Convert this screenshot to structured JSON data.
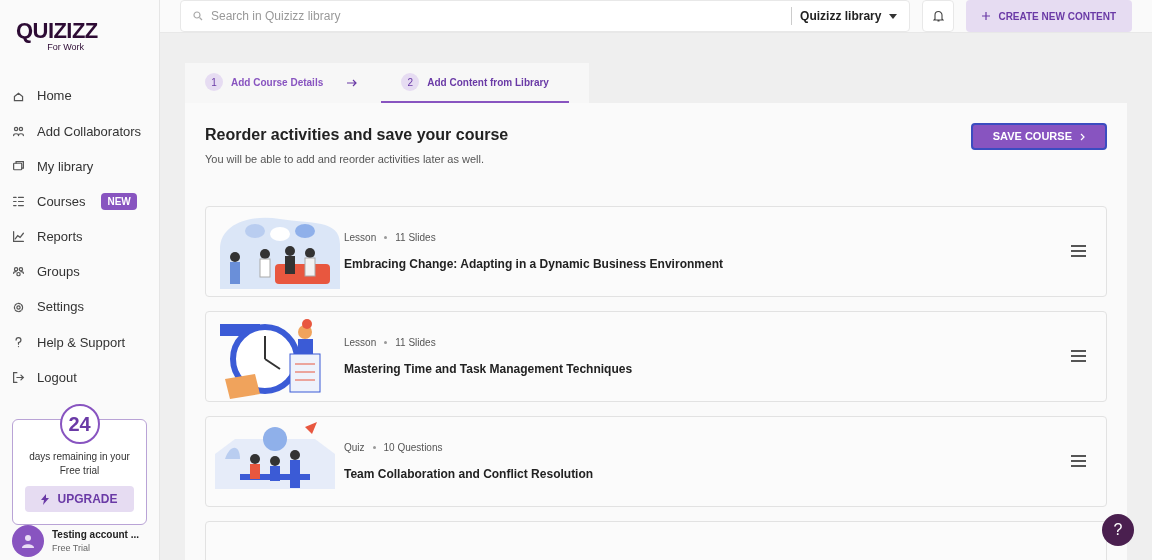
{
  "logo": {
    "name": "QUIZIZZ",
    "sub": "For Work"
  },
  "sidebar": {
    "items": [
      {
        "label": "Home"
      },
      {
        "label": "Add Collaborators"
      },
      {
        "label": "My library"
      },
      {
        "label": "Courses",
        "badge": "NEW"
      },
      {
        "label": "Reports"
      },
      {
        "label": "Groups"
      },
      {
        "label": "Settings"
      },
      {
        "label": "Help & Support"
      },
      {
        "label": "Logout"
      }
    ],
    "trial": {
      "days": "24",
      "text": "days remaining in your Free trial",
      "button": "UPGRADE"
    },
    "account": {
      "name": "Testing account ...",
      "plan": "Free Trial"
    }
  },
  "top_bar": {
    "search": {
      "placeholder": "Search in Quizizz library"
    },
    "library_dropdown": "Quizizz library",
    "create_button": "CREATE NEW CONTENT"
  },
  "steps": [
    {
      "number": "1",
      "label": "Add Course Details",
      "selected": false
    },
    {
      "number": "2",
      "label": "Add Content from Library",
      "selected": true
    }
  ],
  "page": {
    "title": "Reorder activities and save your course",
    "subtitle": "You will be able to add and reorder activities later as well.",
    "save_button": "SAVE COURSE"
  },
  "activities": [
    {
      "type": "Lesson",
      "count": "11 Slides",
      "title": "Embracing Change: Adapting in a Dynamic Business Environment"
    },
    {
      "type": "Lesson",
      "count": "11 Slides",
      "title": "Mastering Time and Task Management Techniques"
    },
    {
      "type": "Quiz",
      "count": "10 Questions",
      "title": "Team Collaboration and Conflict Resolution"
    }
  ],
  "help_button": "?"
}
